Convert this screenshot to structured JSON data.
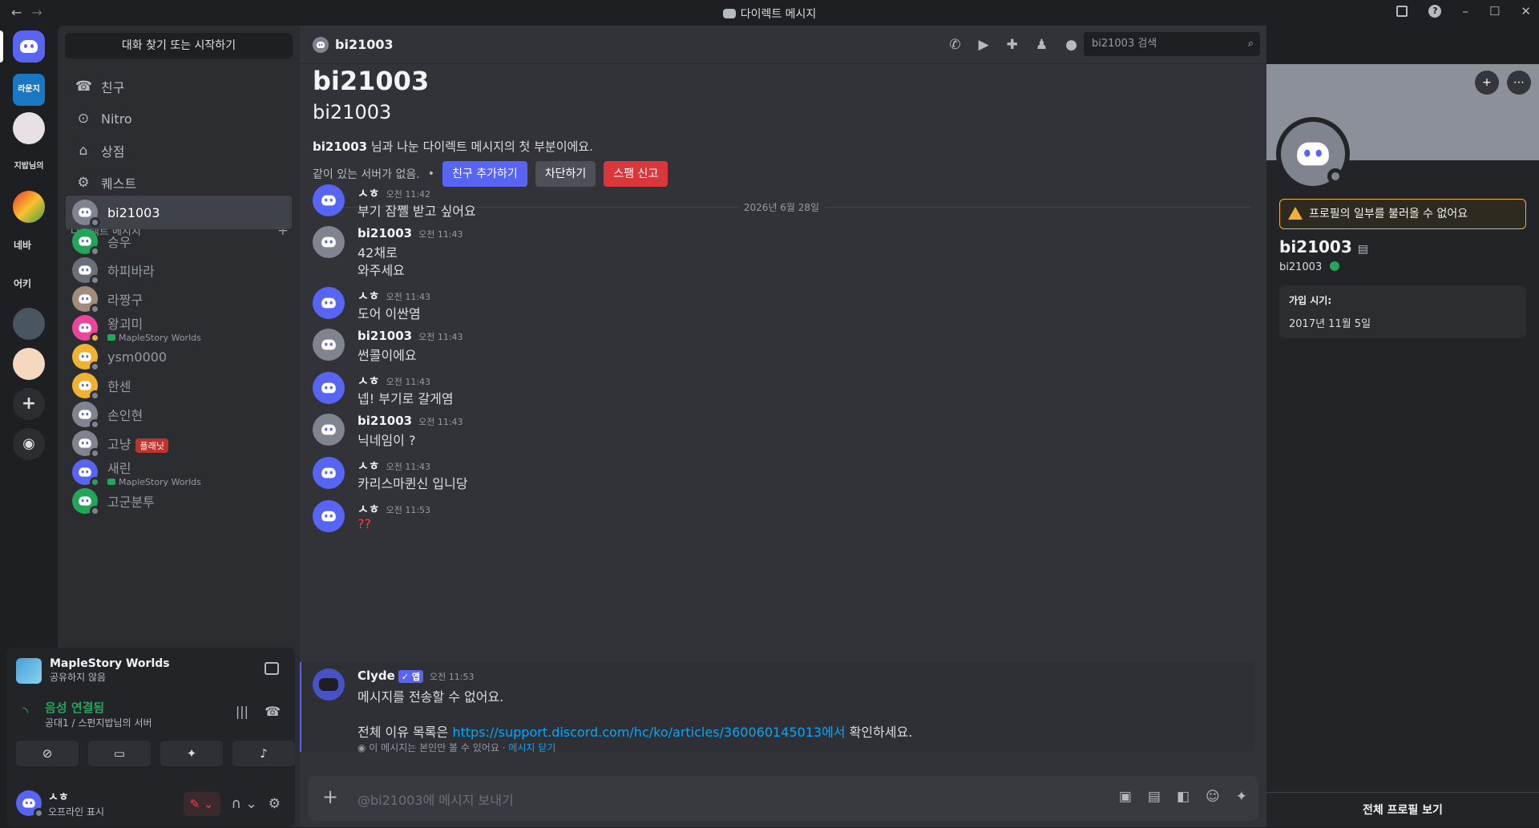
{
  "window": {
    "title": "다이렉트 메시지"
  },
  "sidebar": {
    "search": "대화 찾기 또는 시작하기",
    "nav": [
      {
        "label": "친구",
        "icon": "friends-icon"
      },
      {
        "label": "Nitro",
        "icon": "nitro-icon"
      },
      {
        "label": "상점",
        "icon": "shop-icon"
      },
      {
        "label": "퀘스트",
        "icon": "quest-icon"
      }
    ],
    "dm_header": "다이렉트 메시지",
    "dms": [
      {
        "name": "bi21003",
        "sub": "",
        "color": "#80848e",
        "status": "#80848e",
        "badge": ""
      },
      {
        "name": "승우",
        "sub": "",
        "color": "#23a55a",
        "status": "#80848e",
        "badge": ""
      },
      {
        "name": "하피바라",
        "sub": "",
        "color": "#6b6f78",
        "status": "#80848e",
        "badge": ""
      },
      {
        "name": "라짱구",
        "sub": "",
        "color": "#a08c7a",
        "status": "#80848e",
        "badge": ""
      },
      {
        "name": "왕괴미",
        "sub": "MapleStory Worlds",
        "color": "#eb459e",
        "status": "#f0b232",
        "badge": ""
      },
      {
        "name": "ysm0000",
        "sub": "",
        "color": "#f0b232",
        "status": "#80848e",
        "badge": ""
      },
      {
        "name": "한센",
        "sub": "",
        "color": "#f0b232",
        "status": "#80848e",
        "badge": ""
      },
      {
        "name": "손인현",
        "sub": "",
        "color": "#80848e",
        "status": "#80848e",
        "badge": ""
      },
      {
        "name": "고냥",
        "sub": "",
        "color": "#80848e",
        "status": "#80848e",
        "badge": "플래닛"
      },
      {
        "name": "새린",
        "sub": "MapleStory Worlds",
        "color": "#5865f2",
        "status": "#23a55a",
        "badge": ""
      },
      {
        "name": "고군분투",
        "sub": "",
        "color": "#23a55a",
        "status": "#80848e",
        "badge": ""
      }
    ]
  },
  "servers": [
    {
      "label": "라운지"
    },
    {
      "label": ""
    },
    {
      "label": "지밥님의"
    },
    {
      "label": ""
    },
    {
      "label": "네바"
    },
    {
      "label": "어키"
    },
    {
      "label": ""
    },
    {
      "label": ""
    }
  ],
  "panel": {
    "activity_title": "MapleStory Worlds",
    "activity_sub": "공유하지 않음",
    "voice_title": "음성 연결됨",
    "voice_sub": "공대1 / 스펀지밥님의 서버",
    "user_name": "ㅅㅎ",
    "user_status": "오프라인 표시"
  },
  "chat": {
    "header_name": "bi21003",
    "search_placeholder": "bi21003 검색",
    "intro_title": "bi21003",
    "intro_sub": "bi21003",
    "intro_text_name": "bi21003",
    "intro_text": " 님과 나눈 다이렉트 메시지의 첫 부분이에요.",
    "no_server": "같이 있는 서버가 없음.",
    "btn_add": "친구 추가하기",
    "btn_block": "차단하기",
    "btn_spam": "스팸 신고",
    "date": "2026년 6월 28일",
    "messages": [
      {
        "author": "ㅅㅎ",
        "time": "오전 11:42",
        "lines": [
          "부기 잠쪨 받고 싶어요"
        ],
        "color": "#5865f2"
      },
      {
        "author": "bi21003",
        "time": "오전 11:43",
        "lines": [
          "42채로",
          "와주세요"
        ],
        "color": "#80848e"
      },
      {
        "author": "ㅅㅎ",
        "time": "오전 11:43",
        "lines": [
          "도어 이싼염"
        ],
        "color": "#5865f2"
      },
      {
        "author": "bi21003",
        "time": "오전 11:43",
        "lines": [
          "썬콜이에요"
        ],
        "color": "#80848e"
      },
      {
        "author": "ㅅㅎ",
        "time": "오전 11:43",
        "lines": [
          "넵! 부기로 갈게염"
        ],
        "color": "#5865f2"
      },
      {
        "author": "bi21003",
        "time": "오전 11:43",
        "lines": [
          "닉네임이 ?"
        ],
        "color": "#80848e"
      },
      {
        "author": "ㅅㅎ",
        "time": "오전 11:43",
        "lines": [
          "카리스마퀸신 입니당"
        ],
        "color": "#5865f2"
      },
      {
        "author": "ㅅㅎ",
        "time": "오전 11:53",
        "lines": [
          "??"
        ],
        "color": "#5865f2"
      }
    ],
    "clyde": {
      "author": "Clyde",
      "badge": "✓ 앱",
      "time": "오전 11:53",
      "line1": "메시지를 전송할 수 없어요.",
      "line2_pre": "전체 이유 목록은 ",
      "link": "https://support.discord.com/hc/ko/articles/360060145013에서",
      "line2_post": " 확인하세요.",
      "eph": "이 메시지는 본인만 볼 수 있어요 · ",
      "eph_link": "메시지 닫기"
    },
    "composer_placeholder": "@bi21003에 메시지 보내기"
  },
  "profile": {
    "warning": "프로필의 일부를 불러올 수 없어요",
    "name": "bi21003",
    "username": "bi21003",
    "joined_label": "가입 시기:",
    "joined_value": "2017년 11월 5일",
    "footer": "전체 프로필 보기"
  }
}
